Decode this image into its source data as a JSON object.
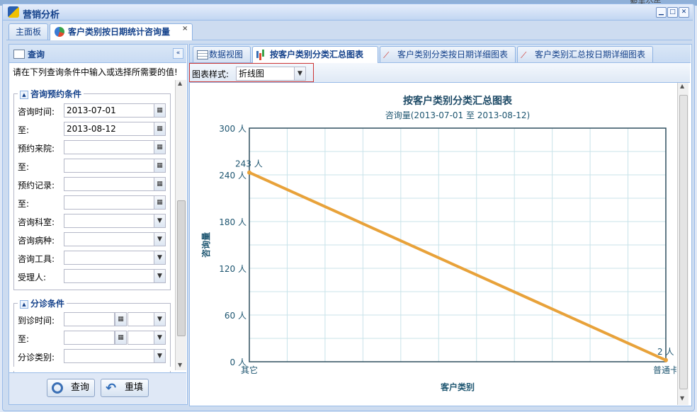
{
  "window": {
    "title": "营销分析",
    "bg_note": "智未公告..."
  },
  "tabs": [
    {
      "label": "主面板"
    },
    {
      "label": "客户类别按日期统计咨询量",
      "close": "×"
    }
  ],
  "query_panel": {
    "title": "查询",
    "collapse": "«",
    "hint": "请在下列查询条件中输入或选择所需要的值!",
    "section1": {
      "title": "咨询预约条件",
      "rows": [
        {
          "label": "咨询时间:",
          "value": "2013-07-01"
        },
        {
          "label": "至:",
          "value": "2013-08-12"
        },
        {
          "label": "预约来院:",
          "value": ""
        },
        {
          "label": "至:",
          "value": ""
        },
        {
          "label": "预约记录:",
          "value": ""
        },
        {
          "label": "至:",
          "value": ""
        },
        {
          "label": "咨询科室:",
          "value": ""
        },
        {
          "label": "咨询病种:",
          "value": ""
        },
        {
          "label": "咨询工具:",
          "value": ""
        },
        {
          "label": "受理人:",
          "value": ""
        }
      ]
    },
    "section2": {
      "title": "分诊条件",
      "rows": [
        {
          "label": "到诊时间:"
        },
        {
          "label": "至:"
        },
        {
          "label": "分诊类别:"
        }
      ]
    },
    "buttons": {
      "query": "查询",
      "reset": "重填"
    }
  },
  "view_tabs": [
    {
      "label": "数据视图"
    },
    {
      "label": "按客户类别分类汇总图表"
    },
    {
      "label": "客户类别分类按日期详细图表"
    },
    {
      "label": "客户类别汇总按日期详细图表"
    }
  ],
  "toolbar": {
    "style_label": "图表样式:",
    "style_value": "折线图"
  },
  "chart_data": {
    "type": "line",
    "title": "按客户类别分类汇总图表",
    "subtitle": "咨询量(2013-07-01 至 2013-08-12)",
    "xlabel": "客户类别",
    "ylabel": "咨询量",
    "categories": [
      "其它",
      "普通卡"
    ],
    "values": [
      243,
      2
    ],
    "data_labels": [
      "243 人",
      "2 人"
    ],
    "ylim": [
      0,
      300
    ],
    "yticks": [
      0,
      60,
      120,
      180,
      240,
      300
    ],
    "ytick_labels": [
      "0 人",
      "60 人",
      "120 人",
      "180 人",
      "240 人",
      "300 人"
    ],
    "grid": true,
    "line_color": "#e8a23a"
  }
}
